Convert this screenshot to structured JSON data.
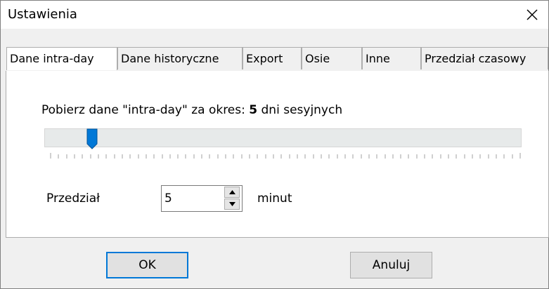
{
  "window": {
    "title": "Ustawienia",
    "close_glyph": "✕"
  },
  "tabs": [
    {
      "label": "Dane intra-day",
      "active": true
    },
    {
      "label": "Dane historyczne",
      "active": false
    },
    {
      "label": "Export",
      "active": false
    },
    {
      "label": "Osie",
      "active": false
    },
    {
      "label": "Inne",
      "active": false
    },
    {
      "label": "Przedział czasowy",
      "active": false
    }
  ],
  "intraday": {
    "info_prefix": "Pobierz dane \"intra-day\" za okres: ",
    "days": "5",
    "info_suffix": " dni sesyjnych",
    "slider": {
      "value": 5,
      "accent": "#0078d7"
    },
    "interval_label": "Przedział",
    "interval_value": "5",
    "interval_unit": "minut"
  },
  "buttons": {
    "ok": "OK",
    "cancel": "Anuluj"
  }
}
